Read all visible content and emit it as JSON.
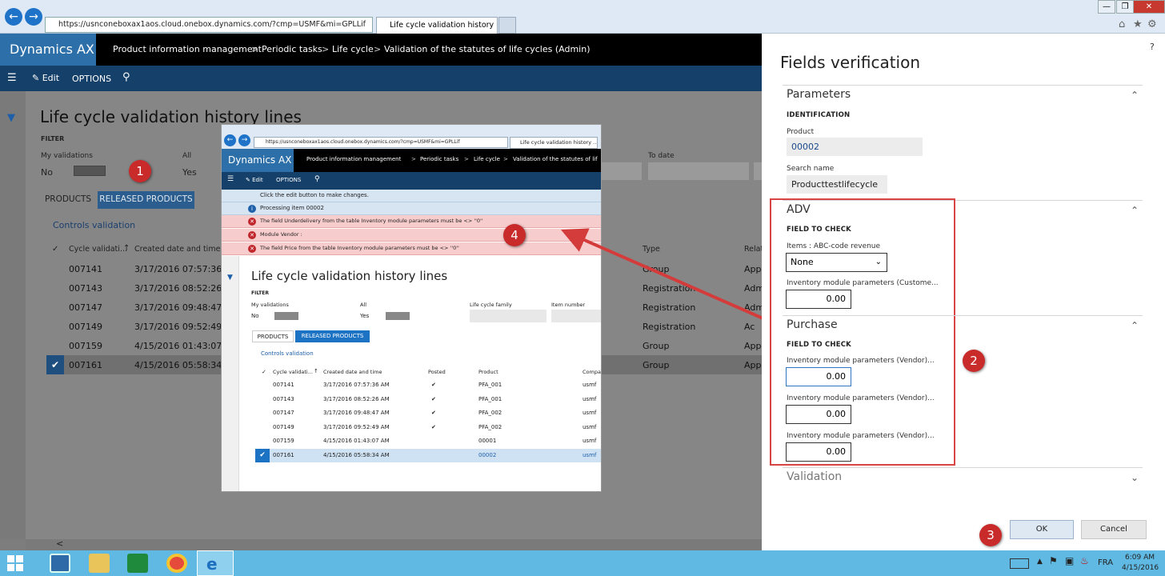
{
  "browser": {
    "url": "https://usnconeboxax1aos.cloud.onebox.dynamics.com/?cmp=USMF&mi=GPLLif",
    "tab_title": "Life cycle validation history ..."
  },
  "app": {
    "brand": "Dynamics AX",
    "breadcrumb": [
      "Product information management",
      "Periodic tasks",
      "Life cycle",
      "Validation of the statutes of life cycles (Admin)"
    ],
    "cmd": {
      "edit": "Edit",
      "options": "OPTIONS"
    }
  },
  "main": {
    "title": "Life cycle validation history lines",
    "filter_label": "FILTER",
    "my_validations_label": "My validations",
    "my_validations_value": "No",
    "all_label": "All",
    "all_value": "Yes",
    "to_date_label": "To date",
    "tabs": [
      "PRODUCTS",
      "RELEASED PRODUCTS"
    ],
    "controls_link": "Controls validation",
    "columns": [
      "Cycle validati...",
      "Created date and time",
      "Type",
      "Relat"
    ],
    "rows": [
      {
        "id": "007141",
        "date": "3/17/2016 07:57:36 AM",
        "type": "Group",
        "rel": "App"
      },
      {
        "id": "007143",
        "date": "3/17/2016 08:52:26 AM",
        "type": "Registration",
        "rel": "Adm"
      },
      {
        "id": "007147",
        "date": "3/17/2016 09:48:47 AM",
        "type": "Registration",
        "rel": "Adm"
      },
      {
        "id": "007149",
        "date": "3/17/2016 09:52:49 AM",
        "type": "Registration",
        "rel": "Ac"
      },
      {
        "id": "007159",
        "date": "4/15/2016 01:43:07 AM",
        "type": "Group",
        "rel": "App"
      },
      {
        "id": "007161",
        "date": "4/15/2016 05:58:34 AM",
        "type": "Group",
        "rel": "App"
      }
    ]
  },
  "inset": {
    "url": "https://usnconeboxax1aos.cloud.onebox.dynamics.com/?cmp=USMF&mi=GPLLif",
    "tab_title": "Life cycle validation history ...",
    "brand": "Dynamics AX",
    "breadcrumb": [
      "Product information management",
      "Periodic tasks",
      "Life cycle",
      "Validation of the statutes of lif"
    ],
    "edit": "Edit",
    "options": "OPTIONS",
    "info_edit": "Click the edit button to make changes.",
    "info_processing": "Processing item 00002",
    "errors": [
      "The field Underdelivery from the table Inventory module parameters must be <> ''0''",
      "Module Vendor :",
      "The field Price from the table Inventory module parameters must be <> ''0''"
    ],
    "title": "Life cycle validation history lines",
    "filter_label": "FILTER",
    "my_validations_label": "My validations",
    "my_validations_value": "No",
    "all_label": "All",
    "all_value": "Yes",
    "lifecycle_family_label": "Life cycle family",
    "item_number_label": "Item number",
    "tabs": [
      "PRODUCTS",
      "RELEASED PRODUCTS"
    ],
    "controls_link": "Controls validation",
    "columns": [
      "Cycle validati...",
      "Created date and time",
      "Posted",
      "Product",
      "Compa"
    ],
    "rows": [
      {
        "id": "007141",
        "date": "3/17/2016 07:57:36 AM",
        "posted": "✔",
        "product": "PFA_001",
        "company": "usmf"
      },
      {
        "id": "007143",
        "date": "3/17/2016 08:52:26 AM",
        "posted": "✔",
        "product": "PFA_001",
        "company": "usmf"
      },
      {
        "id": "007147",
        "date": "3/17/2016 09:48:47 AM",
        "posted": "✔",
        "product": "PFA_002",
        "company": "usmf"
      },
      {
        "id": "007149",
        "date": "3/17/2016 09:52:49 AM",
        "posted": "✔",
        "product": "PFA_002",
        "company": "usmf"
      },
      {
        "id": "007159",
        "date": "4/15/2016 01:43:07 AM",
        "posted": "",
        "product": "00001",
        "company": "usmf"
      },
      {
        "id": "007161",
        "date": "4/15/2016 05:58:34 AM",
        "posted": "",
        "product": "00002",
        "company": "usmf"
      }
    ]
  },
  "panel": {
    "title": "Fields verification",
    "help": "?",
    "parameters": {
      "header": "Parameters",
      "identification": "IDENTIFICATION",
      "product_label": "Product",
      "product_value": "00002",
      "search_label": "Search name",
      "search_value": "Producttestlifecycle"
    },
    "adv": {
      "header": "ADV",
      "field_to_check": "FIELD TO CHECK",
      "items_label": "Items : ABC-code revenue",
      "items_value": "None",
      "inv_label": "Inventory module parameters (Custome...",
      "inv_value": "0.00"
    },
    "purchase": {
      "header": "Purchase",
      "field_to_check": "FIELD TO CHECK",
      "fields": [
        {
          "label": "Inventory module parameters (Vendor)...",
          "value": "0.00"
        },
        {
          "label": "Inventory module parameters (Vendor)...",
          "value": "0.00"
        },
        {
          "label": "Inventory module parameters (Vendor)...",
          "value": "0.00"
        }
      ]
    },
    "validation_header": "Validation",
    "ok": "OK",
    "cancel": "Cancel"
  },
  "badges": [
    "1",
    "2",
    "3",
    "4"
  ],
  "taskbar": {
    "lang": "FRA",
    "time": "6:09 AM",
    "date": "4/15/2016"
  },
  "colors": {
    "accent": "#2d6fa8",
    "cmdbar": "#15406a",
    "annotation": "#c92a2a",
    "error_bg": "#f7cccc"
  }
}
